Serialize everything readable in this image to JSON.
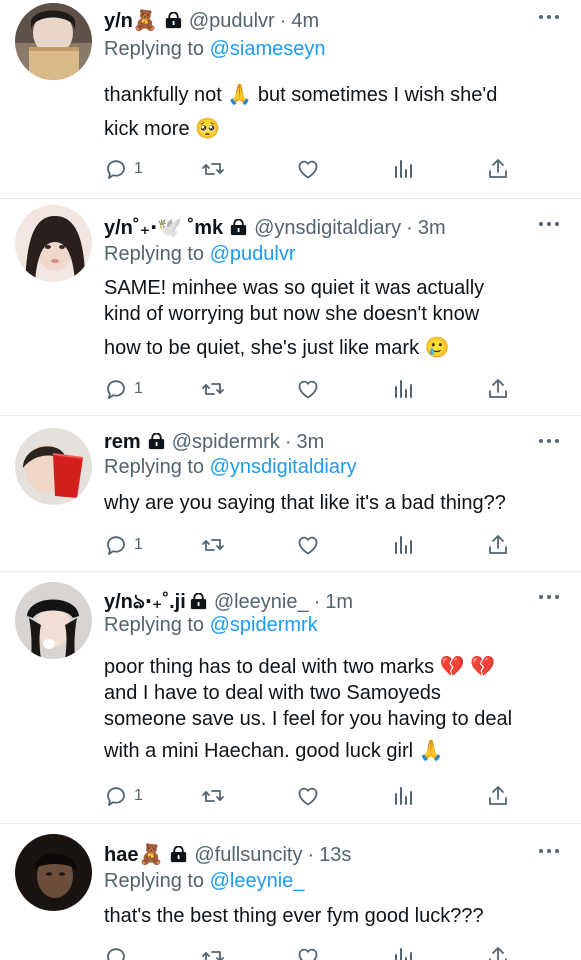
{
  "tweets": [
    {
      "name": "y/n",
      "name_emoji": "🧸",
      "handle": "@pudulvr",
      "time": "4m",
      "reply_prefix": "Replying to",
      "reply_to": "@siameseyn",
      "lines": [
        "thankfully not 🙏  but sometimes I wish she'd",
        "kick more 🥺"
      ],
      "reply_count": "1"
    },
    {
      "name": "y/n",
      "name_emoji": "˚₊‧🕊️ ˚mk",
      "handle": "@ynsdigitaldiary",
      "time": "3m",
      "reply_prefix": "Replying to",
      "reply_to": "@pudulvr",
      "lines": [
        "SAME! minhee was so quiet it was actually",
        "kind of worrying but now she doesn't know",
        "how to be quiet, she's just like mark 🥲"
      ],
      "reply_count": "1"
    },
    {
      "name": "rem",
      "name_emoji": "",
      "handle": "@spidermrk",
      "time": "3m",
      "reply_prefix": "Replying to",
      "reply_to": "@ynsdigitaldiary",
      "lines": [
        "why are you saying that like it's a bad thing??"
      ],
      "reply_count": "1"
    },
    {
      "name": "y/n",
      "name_emoji": "ঌ‧₊˚.ji",
      "handle": "@leeynie_",
      "time": "1m",
      "reply_prefix": "Replying to",
      "reply_to": "@spidermrk",
      "lines": [
        "poor thing has to deal with two marks 💔 💔",
        "and I have to deal with two Samoyeds",
        "someone save us. I feel for you having to deal",
        "with a mini Haechan. good luck girl 🙏"
      ],
      "reply_count": "1"
    },
    {
      "name": "hae",
      "name_emoji": "🧸",
      "handle": "@fullsuncity",
      "time": "13s",
      "reply_prefix": "Replying to",
      "reply_to": "@leeynie_",
      "lines": [
        "that's the best thing ever fym good luck???"
      ],
      "reply_count": ""
    }
  ],
  "separator": "·",
  "icons": [
    "reply-icon",
    "retweet-icon",
    "like-icon",
    "analytics-icon",
    "share-icon",
    "more-icon",
    "lock-icon"
  ],
  "colors": {
    "text": "#0f1419",
    "secondary": "#536471",
    "mention": "#1d9bf0",
    "divider": "#e6ecf0"
  }
}
